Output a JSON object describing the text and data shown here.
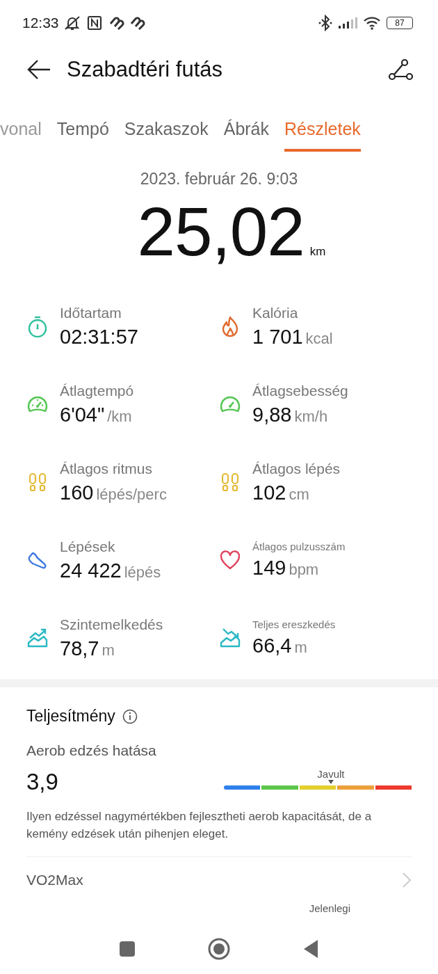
{
  "status_bar": {
    "time": "12:33",
    "battery": "87"
  },
  "header": {
    "title": "Szabadtéri futás"
  },
  "tabs": [
    {
      "label": "vonal",
      "selected": false
    },
    {
      "label": "Tempó",
      "selected": false
    },
    {
      "label": "Szakaszok",
      "selected": false
    },
    {
      "label": "Ábrák",
      "selected": false
    },
    {
      "label": "Részletek",
      "selected": true
    }
  ],
  "summary": {
    "date": "2023. február 26. 9:03",
    "distance": "25,02",
    "unit": "km"
  },
  "stats": [
    {
      "kind": "duration",
      "label": "Időtartam",
      "value": "02:31:57"
    },
    {
      "kind": "calories",
      "label": "Kalória",
      "value": "1 701",
      "unit": "kcal"
    },
    {
      "kind": "pace",
      "label": "Átlagtempó",
      "value": "6'04\"",
      "unit": "/km"
    },
    {
      "kind": "speed",
      "label": "Átlagsebesség",
      "value": "9,88",
      "unit": "km/h"
    },
    {
      "kind": "cadence",
      "label": "Átlagos ritmus",
      "value": "160",
      "unit": "lépés/perc"
    },
    {
      "kind": "stride",
      "label": "Átlagos lépés",
      "value": "102",
      "unit": "cm"
    },
    {
      "kind": "steps",
      "label": "Lépések",
      "value": "24 422",
      "unit": "lépés"
    },
    {
      "kind": "heart-rate",
      "label": "Átlagos pulzusszám",
      "value": "149",
      "unit": "bpm"
    },
    {
      "kind": "ascent",
      "label": "Szintemelkedés",
      "value": "78,7",
      "unit": "m"
    },
    {
      "kind": "descent",
      "label": "Teljes ereszkedés",
      "value": "66,4",
      "unit": "m"
    }
  ],
  "performance": {
    "title": "Teljesítmény",
    "aerobic": {
      "label": "Aerob edzés hatása",
      "value": "3,9",
      "marker_label": "Javult",
      "segments": [
        {
          "color": "#2f80ed"
        },
        {
          "color": "#5cc74a"
        },
        {
          "color": "#e3cf2e"
        },
        {
          "color": "#eba13a"
        },
        {
          "color": "#ee3a2e"
        }
      ],
      "description": "Ilyen edzéssel nagymértékben fejlesztheti aerob kapacitását, de a kemény edzések után pihenjen eleget."
    },
    "vo2max": {
      "label": "VO2Max",
      "current_label": "Jelenlegi"
    }
  }
}
